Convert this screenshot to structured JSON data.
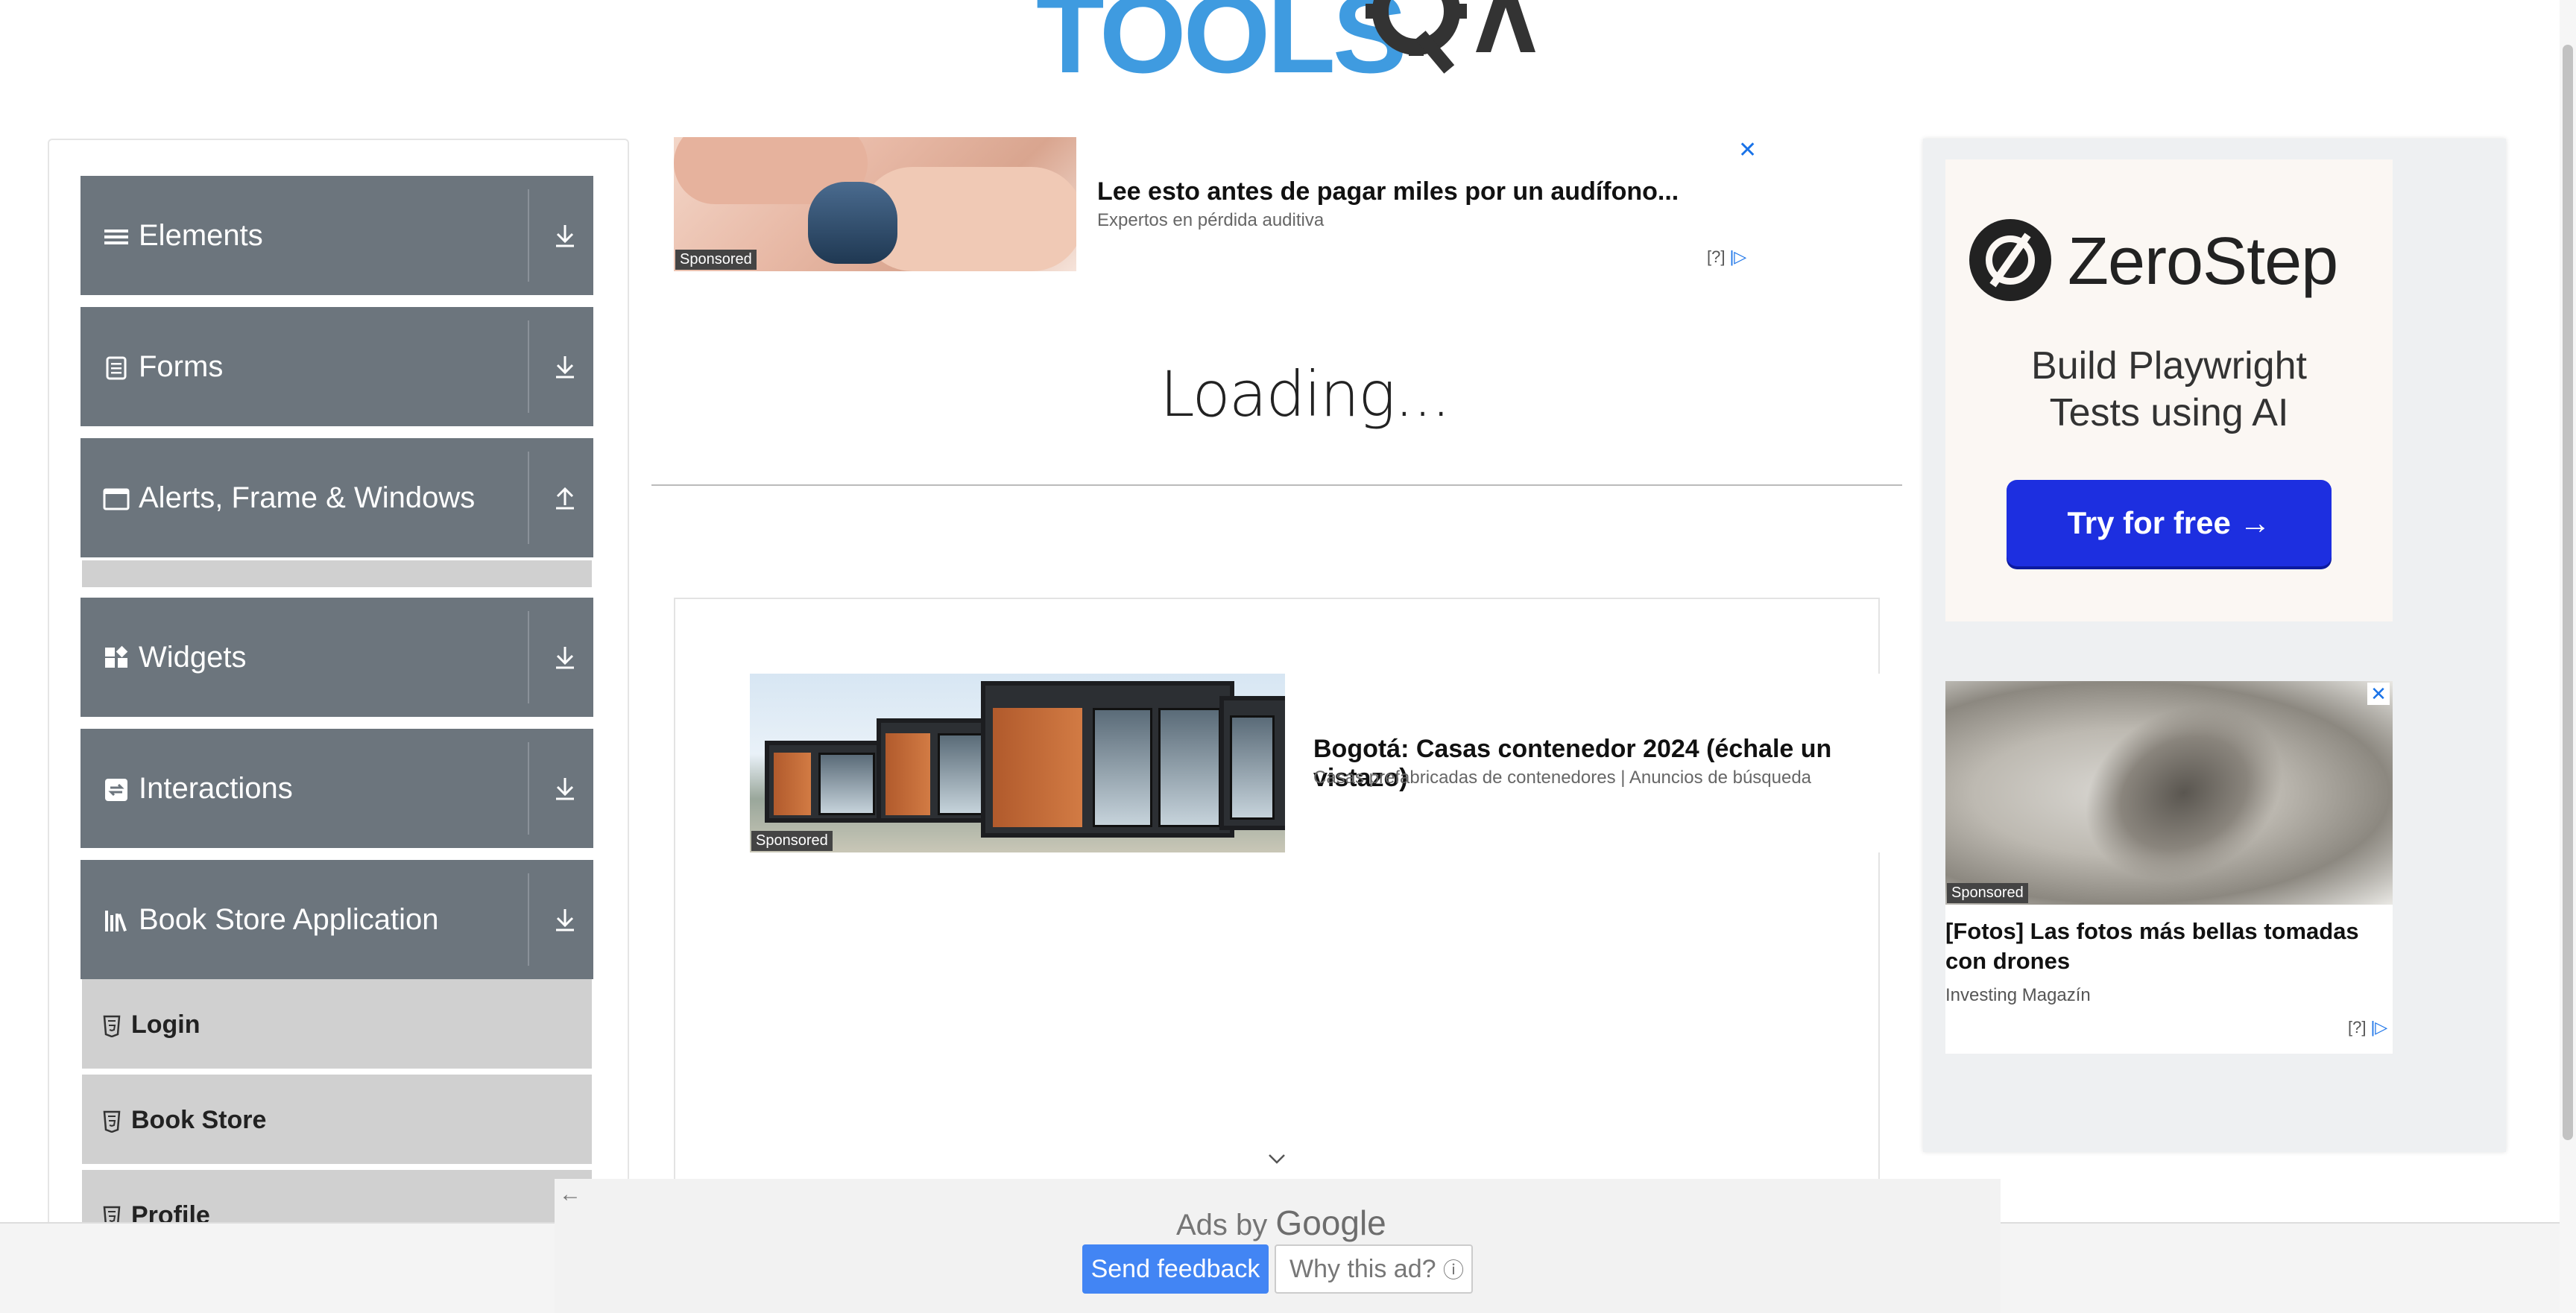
{
  "logo": {
    "text": "TOOLS",
    "accent": "QA"
  },
  "sidebar": {
    "groups": [
      {
        "label": "Elements",
        "icon": "hamburger-icon",
        "toggle": "download-icon"
      },
      {
        "label": "Forms",
        "icon": "form-icon",
        "toggle": "download-icon"
      },
      {
        "label": "Alerts, Frame & Windows",
        "icon": "window-icon",
        "toggle": "upload-icon"
      },
      {
        "label": "Widgets",
        "icon": "widgets-icon",
        "toggle": "download-icon"
      },
      {
        "label": "Interactions",
        "icon": "interactions-icon",
        "toggle": "download-icon"
      },
      {
        "label": "Book Store Application",
        "icon": "books-icon",
        "toggle": "download-icon"
      }
    ],
    "bookstore_items": [
      {
        "label": "Login",
        "icon": "html5-icon"
      },
      {
        "label": "Book Store",
        "icon": "html5-icon"
      },
      {
        "label": "Profile",
        "icon": "html5-icon"
      }
    ]
  },
  "ad_top": {
    "title": "Lee esto antes de pagar miles por un audífono...",
    "subtitle": "Expertos en pérdida auditiva",
    "sponsored": "Sponsored",
    "close": "✕",
    "adchoice": "[?]"
  },
  "main": {
    "loading": "Loading..."
  },
  "ad_mid": {
    "title": "Bogotá: Casas contenedor 2024 (échale un vistazo)",
    "subtitle": "Casas prefabricadas de contenedores | Anuncios de búsqueda",
    "sponsored": "Sponsored"
  },
  "right_ad": {
    "brand": "ZeroStep",
    "tagline_line1": "Build Playwright",
    "tagline_line2": "Tests using AI",
    "cta": "Try for free →"
  },
  "drone_ad": {
    "title": "[Fotos] Las fotos más bellas tomadas con drones",
    "source": "Investing Magazín",
    "sponsored": "Sponsored",
    "close": "✕",
    "adchoice": "[?]"
  },
  "google_ad": {
    "ads_by": "Ads by",
    "google": "Google",
    "send_feedback": "Send feedback",
    "why_this_ad": "Why this ad?",
    "info": "ⓘ"
  },
  "colors": {
    "sidebar_group": "#6c757d",
    "submenu": "#d0d0d0",
    "logo_blue": "#3f9be0",
    "cta_blue": "#1d2fe0",
    "feedback_blue": "#4285f4"
  }
}
